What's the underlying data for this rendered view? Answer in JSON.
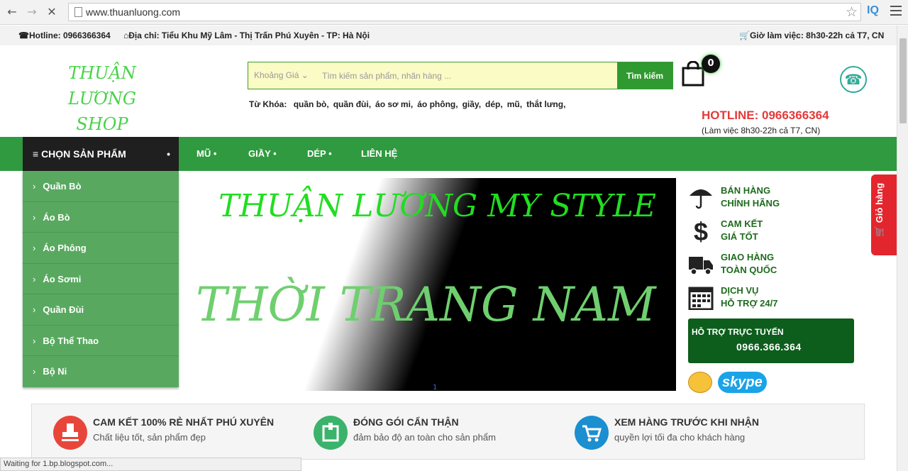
{
  "browser": {
    "url": "www.thuanluong.com",
    "ext_label": "IQ",
    "status": "Waiting for 1.bp.blogspot.com..."
  },
  "topbar": {
    "hotline": "Hotline: 0966366364",
    "address": "Địa chỉ: Tiểu Khu Mỹ Lâm - Thị Trấn Phú Xuyên - TP: Hà Nội",
    "hours": "Giờ làm việc: 8h30-22h cả T7, CN"
  },
  "header": {
    "logo_line1": "THUẬN LƯƠNG",
    "logo_line2": "SHOP",
    "price_select": "Khoảng Giá",
    "search_placeholder": "Tìm kiếm sản phẩm, nhãn hàng ...",
    "search_button": "Tìm kiếm",
    "keywords_label": "Từ Khóa:",
    "keywords": [
      "quần bò,",
      "quần đùi,",
      "áo sơ mi,",
      "áo phông,",
      "giầy,",
      "dép,",
      "mũ,",
      "thắt lưng,"
    ],
    "cart_count": "0",
    "hotline": "HOTLINE: 0966366364",
    "hours": "(Làm việc 8h30-22h cả T7, CN)"
  },
  "nav": {
    "category_button": "CHỌN SẢN PHẨM",
    "links": [
      "MŨ",
      "GIẦY",
      "DÉP",
      "LIÊN HỆ"
    ]
  },
  "categories": [
    "Quần Bò",
    "Áo Bò",
    "Áo Phông",
    "Áo Sơmi",
    "Quần Đùi",
    "Bộ Thể Thao",
    "Bộ Ni"
  ],
  "banner": {
    "line1": "THUẬN LƯƠNG MY STYLE",
    "line2": "THỜI TRANG NAM",
    "page": "1"
  },
  "features": [
    {
      "line1": "BÁN HÀNG",
      "line2": "CHÍNH HÃNG",
      "icon": "umbrella-icon"
    },
    {
      "line1": "CAM KẾT",
      "line2": "GIÁ TỐT",
      "icon": "dollar-icon"
    },
    {
      "line1": "GIAO HÀNG",
      "line2": "TOÀN QUỐC",
      "icon": "truck-icon"
    },
    {
      "line1": "DỊCH VỤ",
      "line2": "HỖ TRỢ 24/7",
      "icon": "calendar-icon"
    }
  ],
  "support": {
    "title": "HỖ TRỢ TRỰC TUYẾN",
    "phone": "0966.366.364",
    "skype": "skype"
  },
  "side_cart": "Giỏ hàng",
  "commitments": [
    {
      "title": "CAM KẾT 100% RẺ NHẤT PHÚ XUYÊN",
      "sub": "Chất liệu tốt, sản phẩm đẹp",
      "color": "#e8463a"
    },
    {
      "title": "ĐÓNG GÓI CẨN THẬN",
      "sub": "đảm bảo độ an toàn cho sản phẩm",
      "color": "#3bb36b"
    },
    {
      "title": "XEM HÀNG TRƯỚC KHI NHẬN",
      "sub": "quyền lợi tối đa cho khách hàng",
      "color": "#1b8fd0"
    }
  ],
  "colors": {
    "brand_green": "#2f9a3f",
    "hotline_red": "#e43a3a"
  }
}
